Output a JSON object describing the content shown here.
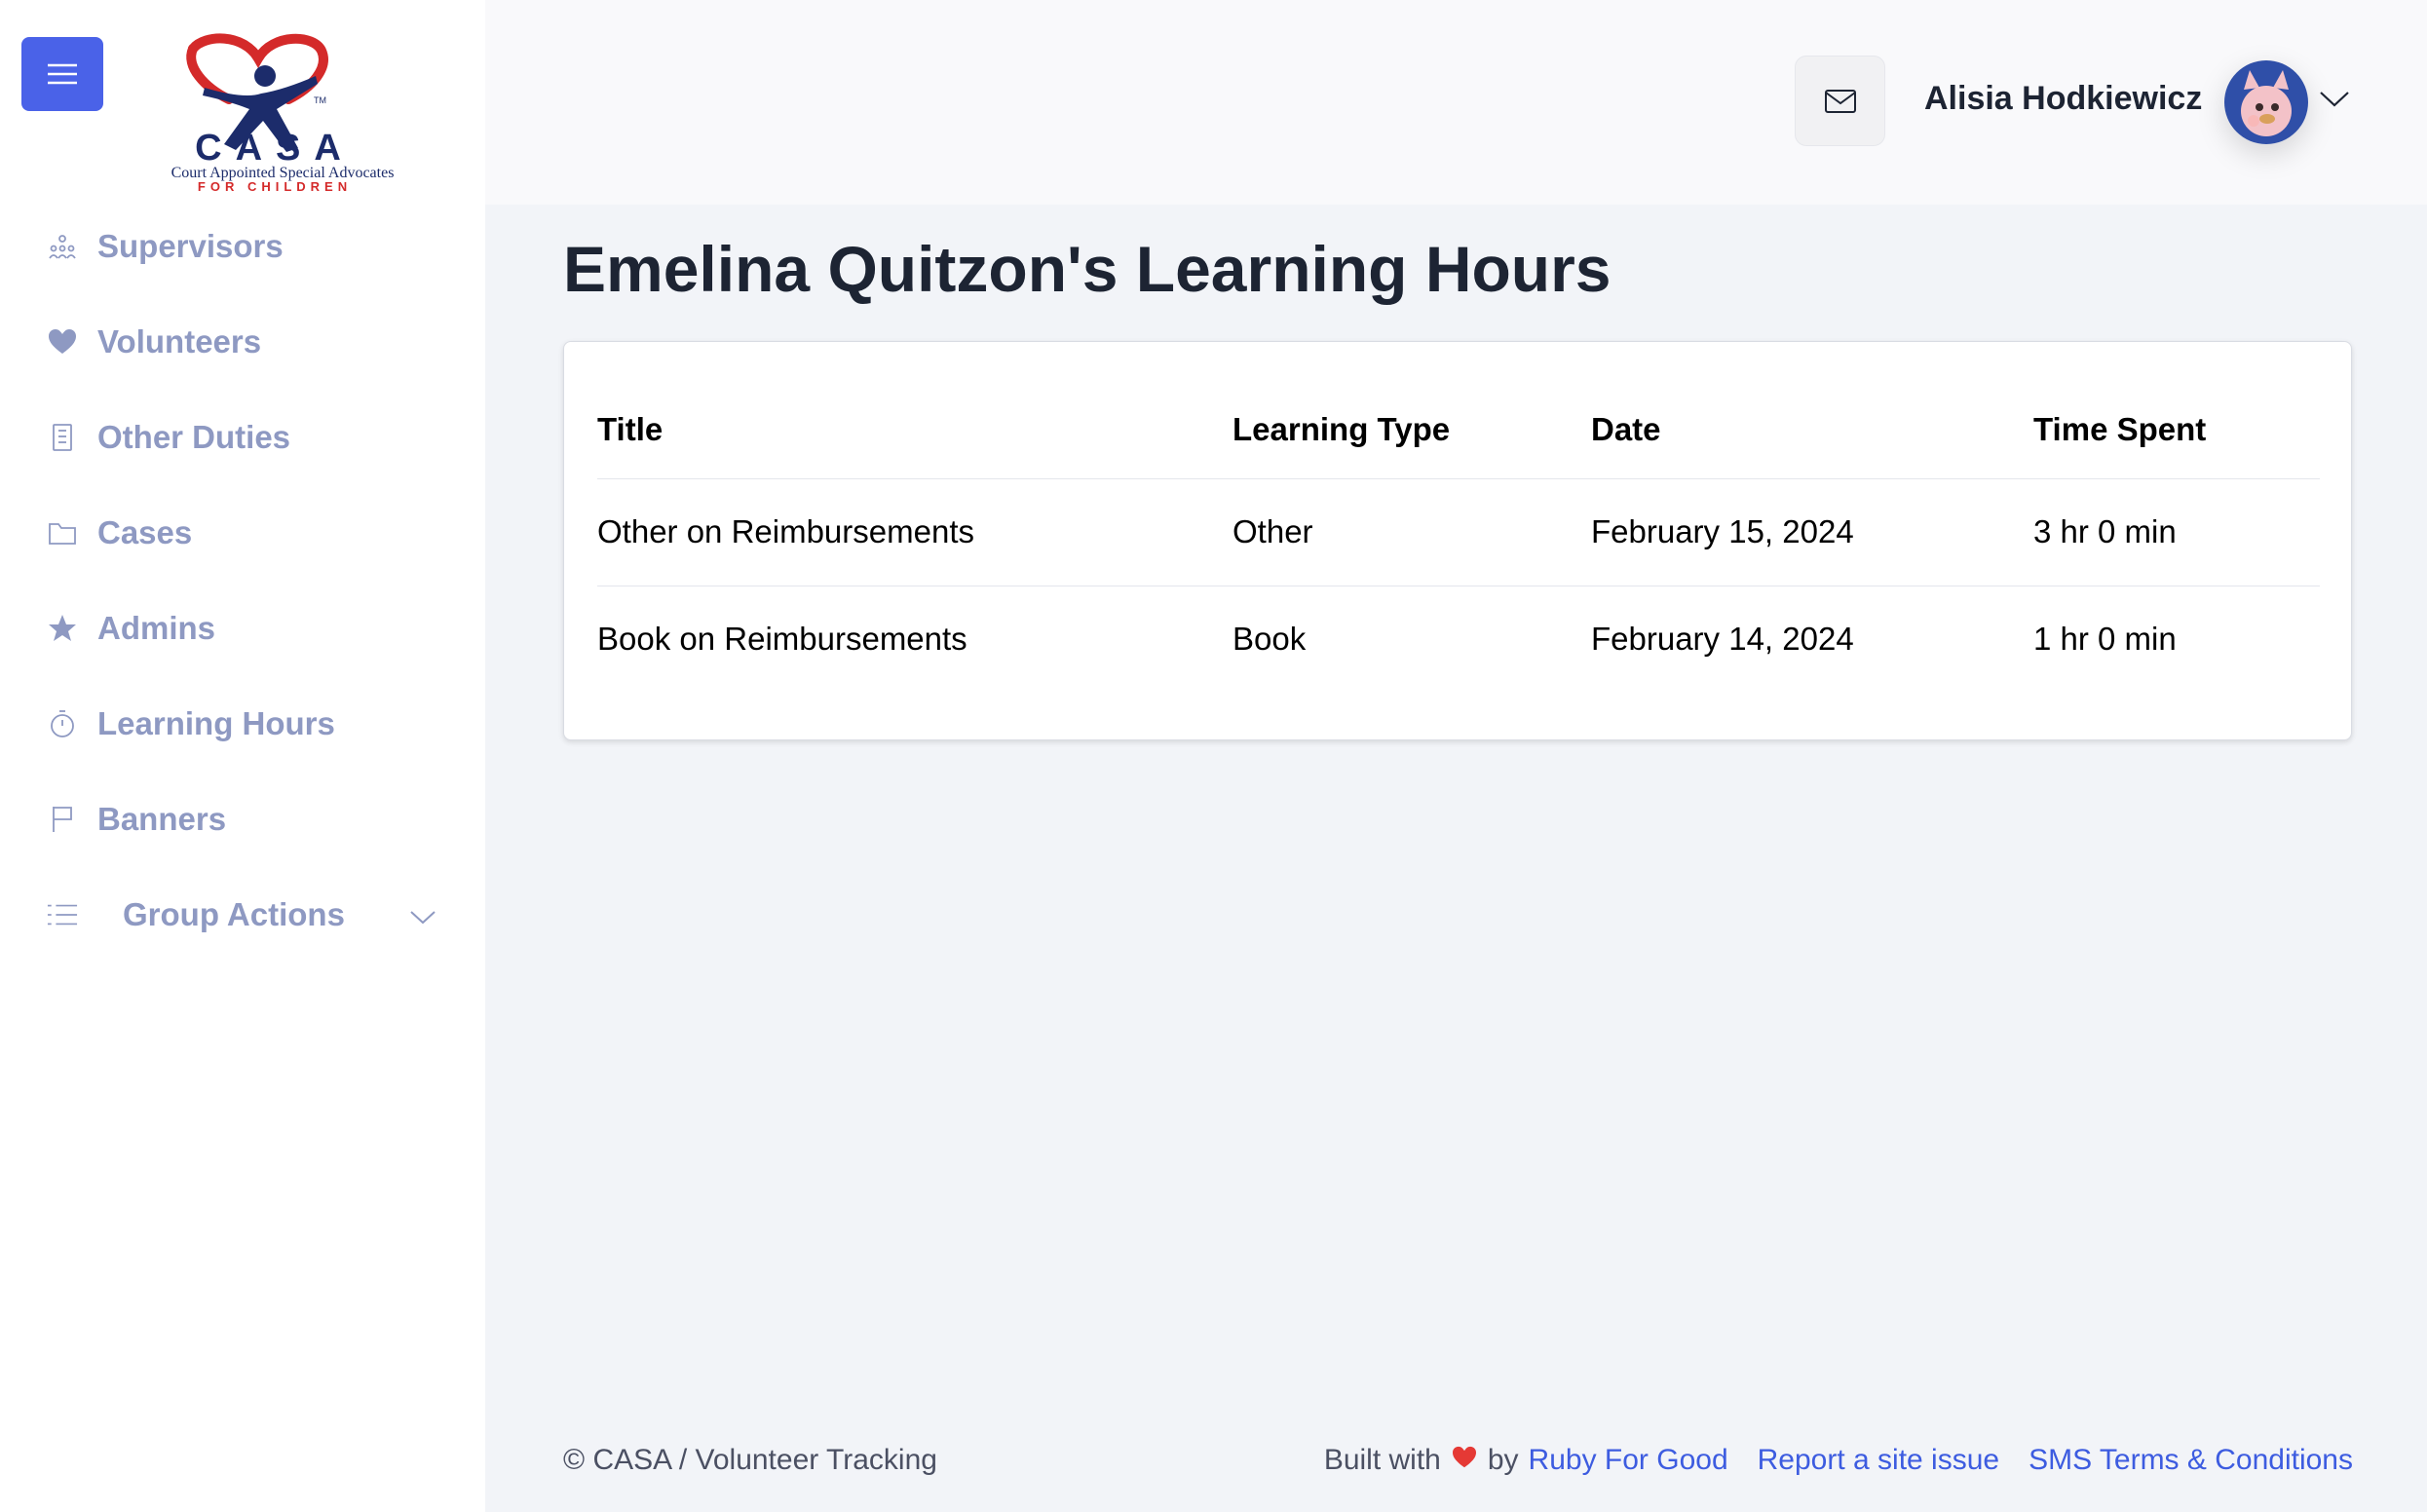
{
  "brand": {
    "logo_letters": "CASA",
    "logo_tagline": "Court Appointed Special Advocates",
    "logo_subtagline": "FOR CHILDREN",
    "logo_tm": "TM"
  },
  "sidebar": {
    "items": [
      {
        "label": "Supervisors",
        "icon": "supervisors-icon"
      },
      {
        "label": "Volunteers",
        "icon": "heart-icon"
      },
      {
        "label": "Other Duties",
        "icon": "building-icon"
      },
      {
        "label": "Cases",
        "icon": "folder-icon"
      },
      {
        "label": "Admins",
        "icon": "star-icon"
      },
      {
        "label": "Learning Hours",
        "icon": "stopwatch-icon"
      },
      {
        "label": "Banners",
        "icon": "flag-icon"
      },
      {
        "label": "Group Actions",
        "icon": "list-icon"
      }
    ]
  },
  "header": {
    "user_name": "Alisia Hodkiewicz"
  },
  "main": {
    "title": "Emelina Quitzon's Learning Hours",
    "table": {
      "headers": [
        "Title",
        "Learning Type",
        "Date",
        "Time Spent"
      ],
      "rows": [
        [
          "Other on Reimbursements",
          "Other",
          "February 15, 2024",
          "3 hr 0 min"
        ],
        [
          "Book on Reimbursements",
          "Book",
          "February 14, 2024",
          "1 hr 0 min"
        ]
      ]
    }
  },
  "footer": {
    "copyright": "© CASA / Volunteer Tracking",
    "built_with": "Built with",
    "by": "by",
    "ruby_link": "Ruby For Good",
    "report_link": "Report a site issue",
    "sms_link": "SMS Terms & Conditions"
  },
  "colors": {
    "accent": "#4a62e8",
    "link": "#3d5ce0",
    "nav_text": "#8e99c2",
    "heart": "#e53935"
  }
}
